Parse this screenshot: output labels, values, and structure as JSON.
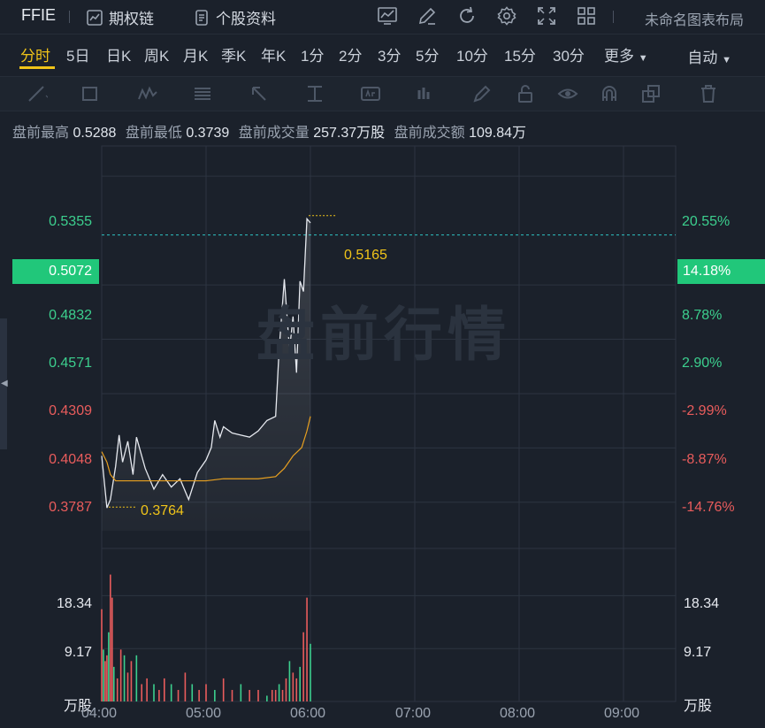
{
  "topbar": {
    "symbol": "FFIE",
    "options_chain": "期权链",
    "stock_profile": "个股资料",
    "layout_name": "未命名图表布局"
  },
  "periods": [
    "分时",
    "5日",
    "日K",
    "周K",
    "月K",
    "季K",
    "年K",
    "1分",
    "2分",
    "3分",
    "5分",
    "10分",
    "15分",
    "30分",
    "更多"
  ],
  "auto_label": "自动",
  "stats": {
    "high_label": "盘前最高",
    "high": "0.5288",
    "low_label": "盘前最低",
    "low": "0.3739",
    "vol_label": "盘前成交量",
    "vol": "257.37万股",
    "amt_label": "盘前成交额",
    "amt": "109.84万"
  },
  "watermark": "盘前行情",
  "price_axis": [
    "0.5355",
    "0.4832",
    "0.4571",
    "0.4309",
    "0.4048",
    "0.3787"
  ],
  "pct_axis": [
    "20.55%",
    "8.78%",
    "2.90%",
    "-2.99%",
    "-8.87%",
    "-14.76%"
  ],
  "current": {
    "price": "0.5072",
    "pct": "14.18%"
  },
  "annotations": {
    "high": "0.5165",
    "low": "0.3764"
  },
  "vol_axis": {
    "top": "18.34",
    "mid": "9.17",
    "unit": "万股"
  },
  "time_axis": [
    "04:00",
    "05:00",
    "06:00",
    "07:00",
    "08:00",
    "09:00"
  ],
  "colors": {
    "up": "#3ccf8e",
    "down": "#e95c5c",
    "price_line": "#e6e9ef",
    "avg_line": "#e8a020",
    "accent": "#f0c419"
  },
  "chart_data": {
    "type": "line",
    "x_range": [
      "04:00",
      "09:30"
    ],
    "price_range": [
      0.365,
      0.55
    ],
    "series": [
      {
        "x": [
          "04:00",
          "04:03",
          "04:05",
          "04:08",
          "04:10",
          "04:12",
          "04:15",
          "04:18",
          "04:20",
          "04:25",
          "04:30",
          "04:35",
          "04:40",
          "04:45",
          "04:50",
          "04:55",
          "05:00",
          "05:03",
          "05:05",
          "05:08",
          "05:10",
          "05:15",
          "05:20",
          "05:25",
          "05:30",
          "05:35",
          "05:40",
          "05:42",
          "05:45",
          "05:48",
          "05:50",
          "05:52",
          "05:54",
          "05:56",
          "05:58",
          "06:00"
        ],
        "values": [
          0.401,
          0.376,
          0.38,
          0.396,
          0.411,
          0.398,
          0.408,
          0.392,
          0.41,
          0.395,
          0.385,
          0.392,
          0.386,
          0.39,
          0.38,
          0.393,
          0.399,
          0.405,
          0.418,
          0.41,
          0.415,
          0.412,
          0.411,
          0.41,
          0.413,
          0.418,
          0.42,
          0.452,
          0.486,
          0.452,
          0.468,
          0.441,
          0.485,
          0.48,
          0.515,
          0.513
        ]
      },
      {
        "x": [
          "04:00",
          "04:03",
          "04:05",
          "04:08",
          "04:10",
          "04:15",
          "04:20",
          "04:30",
          "04:40",
          "04:50",
          "05:00",
          "05:10",
          "05:20",
          "05:30",
          "05:40",
          "05:45",
          "05:50",
          "05:55",
          "05:58",
          "06:00"
        ],
        "values": [
          0.403,
          0.398,
          0.392,
          0.389,
          0.389,
          0.389,
          0.389,
          0.389,
          0.389,
          0.389,
          0.389,
          0.39,
          0.39,
          0.39,
          0.391,
          0.395,
          0.401,
          0.405,
          0.413,
          0.42
        ]
      }
    ],
    "volume_x": [
      "04:00",
      "04:01",
      "04:02",
      "04:03",
      "04:04",
      "04:05",
      "04:06",
      "04:07",
      "04:09",
      "04:11",
      "04:13",
      "04:15",
      "04:17",
      "04:20",
      "04:23",
      "04:26",
      "04:30",
      "04:33",
      "04:36",
      "04:40",
      "04:44",
      "04:48",
      "04:52",
      "04:56",
      "05:00",
      "05:05",
      "05:10",
      "05:15",
      "05:20",
      "05:25",
      "05:30",
      "05:35",
      "05:38",
      "05:40",
      "05:42",
      "05:44",
      "05:46",
      "05:48",
      "05:50",
      "05:52",
      "05:54",
      "05:56",
      "05:58",
      "06:00"
    ],
    "volume_values": [
      16,
      9,
      7,
      8,
      12,
      22,
      18,
      6,
      4,
      9,
      8,
      5,
      7,
      8,
      3,
      4,
      3,
      2,
      4,
      3,
      2,
      5,
      3,
      2,
      3,
      2,
      4,
      2,
      3,
      2,
      2,
      1,
      2,
      2,
      3,
      2,
      4,
      7,
      5,
      4,
      6,
      12,
      18,
      10
    ],
    "volume_range": [
      0,
      25
    ]
  }
}
